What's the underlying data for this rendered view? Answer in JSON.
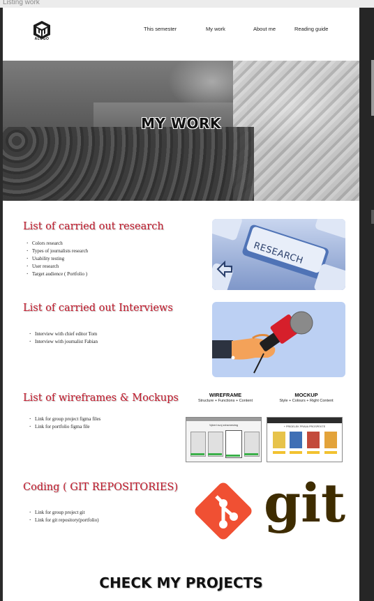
{
  "window": {
    "title": "Listing work"
  },
  "logo": {
    "text": "ALOGO"
  },
  "nav": {
    "items": [
      "This semester",
      "My work",
      "About me",
      "Reading guide"
    ]
  },
  "hero": {
    "title": "MY WORK"
  },
  "sections": [
    {
      "title": "List of carried out research",
      "items": [
        "Colors research",
        "Types of journalists research",
        "Usability testing",
        "User research",
        "Target audience ( Portfolio )"
      ],
      "image": {
        "key_label": "RESEARCH"
      }
    },
    {
      "title": "List of carried out Interviews",
      "items": [
        "Interview with chief editor Tom",
        "Interview with journalist Fabian"
      ]
    },
    {
      "title": "List of wireframes & Mockups",
      "items": [
        "Link for group project figma files",
        "Link for portfolio figma file"
      ],
      "image": {
        "wireframe_title": "WIREFRAME",
        "wireframe_sub": "Structure + Functions + Content",
        "wireframe_screen_heading": "Vyberi svoj zdravnesimg",
        "mockup_title": "MOCKUP",
        "mockup_sub": "Style + Colours + Right Content",
        "mockup_screen_heading": "+ PRIDELEK PRAVA PROSPEKTE"
      }
    },
    {
      "title": "Coding ( GIT REPOSITORIES)",
      "items": [
        "Link for group project git",
        "Link for git repository(portfolio)"
      ],
      "image": {
        "wordmark": "git"
      }
    }
  ],
  "footer": {
    "title": "CHECK MY PROJECTS"
  },
  "colors": {
    "accent": "#c0182a",
    "research_card": "#9fb3df",
    "interview_card": "#bcd0f3",
    "git_orange": "#f05033",
    "git_dark": "#3e2c00"
  }
}
